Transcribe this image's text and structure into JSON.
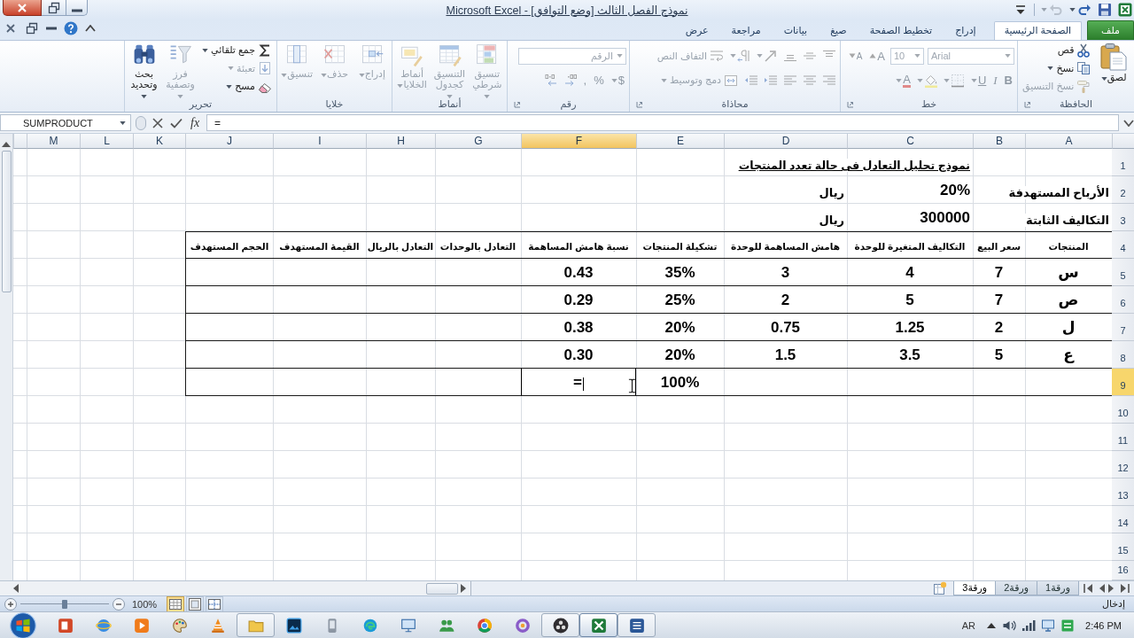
{
  "window": {
    "title": "نموذج الفصل الثالث [وضع التوافق] - Microsoft Excel"
  },
  "quick_access": [
    {
      "disabled": false
    },
    {
      "disabled": false
    },
    {
      "disabled": true
    }
  ],
  "ribbon_tabs": [
    {
      "kind": "file",
      "label": "ملف",
      "selected": false
    },
    {
      "kind": "tab",
      "label": "الصفحة الرئيسية",
      "selected": true
    },
    {
      "kind": "tab",
      "label": "إدراج",
      "selected": false
    },
    {
      "kind": "tab",
      "label": "تخطيط الصفحة",
      "selected": false
    },
    {
      "kind": "tab",
      "label": "صيغ",
      "selected": false
    },
    {
      "kind": "tab",
      "label": "بيانات",
      "selected": false
    },
    {
      "kind": "tab",
      "label": "مراجعة",
      "selected": false
    },
    {
      "kind": "tab",
      "label": "عرض",
      "selected": false
    }
  ],
  "ribbon": {
    "groups": [
      {
        "label": "الحافظة",
        "launcher": true,
        "blocks": [
          {
            "kind": "large",
            "label": "لصق",
            "dropdown": true,
            "disabled": false
          },
          {
            "kind": "rows",
            "rows": [
              {
                "items": [
                  {
                    "kind": "button",
                    "label": "قص",
                    "dropdown": false,
                    "disabled": false
                  }
                ]
              },
              {
                "items": [
                  {
                    "kind": "button",
                    "label": "نسخ",
                    "dropdown": true,
                    "disabled": false
                  }
                ]
              },
              {
                "items": [
                  {
                    "kind": "button",
                    "label": "نسخ التنسيق",
                    "dropdown": false,
                    "disabled": true
                  }
                ]
              }
            ]
          }
        ]
      },
      {
        "label": "خط",
        "launcher": true,
        "blocks": [
          {
            "kind": "rows",
            "rows": [
              {
                "items": [
                  {
                    "kind": "combo",
                    "value": "Arial",
                    "dropdown": true,
                    "disabled": true
                  },
                  {
                    "kind": "combo",
                    "value": "10",
                    "dropdown": true,
                    "disabled": true
                  },
                  {
                    "kind": "glyph",
                    "label": "A",
                    "dropdown": false,
                    "disabled": true
                  },
                  {
                    "kind": "glyph",
                    "label": "A",
                    "dropdown": false,
                    "disabled": true
                  }
                ]
              },
              {
                "items": [
                  {
                    "kind": "glyph",
                    "label": "B",
                    "dropdown": false,
                    "disabled": true
                  },
                  {
                    "kind": "glyph",
                    "label": "I",
                    "dropdown": false,
                    "disabled": true
                  },
                  {
                    "kind": "glyph",
                    "label": "U",
                    "dropdown": true,
                    "disabled": true
                  },
                  {
                    "kind": "icon",
                    "dropdown": true,
                    "disabled": true
                  },
                  {
                    "kind": "icon",
                    "dropdown": true,
                    "disabled": true
                  },
                  {
                    "kind": "glyph",
                    "label": "A",
                    "dropdown": true,
                    "disabled": true
                  }
                ]
              }
            ]
          }
        ]
      },
      {
        "label": "محاذاة",
        "launcher": true,
        "blocks": [
          {
            "kind": "rows",
            "rows": [
              {
                "items": [
                  {
                    "kind": "icon",
                    "dropdown": false,
                    "disabled": true
                  },
                  {
                    "kind": "icon",
                    "dropdown": false,
                    "disabled": true
                  },
                  {
                    "kind": "icon",
                    "dropdown": false,
                    "disabled": true
                  },
                  {
                    "kind": "icon",
                    "dropdown": true,
                    "disabled": true
                  },
                  {
                    "kind": "icon",
                    "dropdown": true,
                    "disabled": true
                  },
                  {
                    "kind": "button",
                    "label": "التفاف النص",
                    "dropdown": false,
                    "disabled": true
                  }
                ]
              },
              {
                "items": [
                  {
                    "kind": "icon",
                    "dropdown": false,
                    "disabled": true
                  },
                  {
                    "kind": "icon",
                    "dropdown": false,
                    "disabled": true
                  },
                  {
                    "kind": "icon",
                    "dropdown": false,
                    "disabled": true
                  },
                  {
                    "kind": "icon",
                    "dropdown": false,
                    "disabled": true
                  },
                  {
                    "kind": "icon",
                    "dropdown": false,
                    "disabled": true
                  },
                  {
                    "kind": "button",
                    "label": "دمج وتوسيط",
                    "dropdown": true,
                    "disabled": true
                  }
                ]
              }
            ]
          }
        ]
      },
      {
        "label": "رقم",
        "launcher": true,
        "blocks": [
          {
            "kind": "rows",
            "rows": [
              {
                "items": [
                  {
                    "kind": "combo",
                    "value": "الرقم",
                    "dropdown": true,
                    "disabled": true
                  }
                ]
              },
              {
                "items": [
                  {
                    "kind": "glyph",
                    "label": "$",
                    "dropdown": true,
                    "disabled": true
                  },
                  {
                    "kind": "glyph",
                    "label": "%",
                    "dropdown": false,
                    "disabled": true
                  },
                  {
                    "kind": "glyph",
                    "label": ",",
                    "dropdown": false,
                    "disabled": true
                  },
                  {
                    "kind": "icon",
                    "dropdown": false,
                    "disabled": true
                  },
                  {
                    "kind": "icon",
                    "dropdown": false,
                    "disabled": true
                  }
                ]
              }
            ]
          }
        ]
      },
      {
        "label": "أنماط",
        "launcher": false,
        "blocks": [
          {
            "kind": "large",
            "label": "تنسيق شرطي",
            "dropdown": true,
            "disabled": true
          },
          {
            "kind": "large",
            "label": "التنسيق كجدول",
            "dropdown": true,
            "disabled": true
          },
          {
            "kind": "large",
            "label": "أنماط الخلايا",
            "dropdown": true,
            "disabled": true
          }
        ]
      },
      {
        "label": "خلايا",
        "launcher": false,
        "blocks": [
          {
            "kind": "large",
            "label": "إدراج",
            "dropdown": true,
            "disabled": true
          },
          {
            "kind": "large",
            "label": "حذف",
            "dropdown": true,
            "disabled": true
          },
          {
            "kind": "large",
            "label": "تنسيق",
            "dropdown": true,
            "disabled": true
          }
        ]
      },
      {
        "label": "تحرير",
        "launcher": false,
        "blocks": [
          {
            "kind": "rows",
            "rows": [
              {
                "items": [
                  {
                    "kind": "button",
                    "label": "جمع تلقائي",
                    "dropdown": true,
                    "disabled": false
                  }
                ]
              },
              {
                "items": [
                  {
                    "kind": "button",
                    "label": "تعبئة",
                    "dropdown": true,
                    "disabled": true
                  }
                ]
              },
              {
                "items": [
                  {
                    "kind": "button",
                    "label": "مسح",
                    "dropdown": true,
                    "disabled": false
                  }
                ]
              }
            ]
          },
          {
            "kind": "large",
            "label": "فرز وتصفية",
            "dropdown": true,
            "disabled": true
          },
          {
            "kind": "large",
            "label": "بحث وتحديد",
            "dropdown": true,
            "disabled": false
          }
        ]
      }
    ]
  },
  "formula_bar": {
    "name_box": "SUMPRODUCT",
    "function_button": "fx",
    "content": "="
  },
  "sheet": {
    "edit_mode": true,
    "columns": [
      {
        "label": "A",
        "selected": false
      },
      {
        "label": "B",
        "selected": false
      },
      {
        "label": "C",
        "selected": false
      },
      {
        "label": "D",
        "selected": false
      },
      {
        "label": "E",
        "selected": false
      },
      {
        "label": "F",
        "selected": true
      },
      {
        "label": "G",
        "selected": false
      },
      {
        "label": "H",
        "selected": false
      },
      {
        "label": "I",
        "selected": false
      },
      {
        "label": "J",
        "selected": false
      },
      {
        "label": "K",
        "selected": false
      },
      {
        "label": "L",
        "selected": false
      },
      {
        "label": "M",
        "selected": false
      }
    ],
    "rows": [
      {
        "label": "1",
        "selected": false,
        "cells": [
          {
            "kind": "blank"
          },
          {
            "kind": "blank"
          },
          {
            "kind": "title",
            "text": "نموذج تحليل التعادل فى حالة تعدد المنتجات"
          }
        ]
      },
      {
        "label": "2",
        "selected": false,
        "cells": [
          {
            "kind": "label",
            "text": "الأرباح المستهدفة"
          },
          {
            "kind": "blank"
          },
          {
            "kind": "number",
            "text": "20%"
          },
          {
            "kind": "label",
            "text": "ريال"
          }
        ]
      },
      {
        "label": "3",
        "selected": false,
        "cells": [
          {
            "kind": "label",
            "text": "التكاليف الثابتة"
          },
          {
            "kind": "blank"
          },
          {
            "kind": "number",
            "text": "300000"
          },
          {
            "kind": "label",
            "text": "ريال"
          }
        ]
      },
      {
        "label": "4",
        "selected": false,
        "cells": [
          {
            "kind": "header",
            "text": "المنتجات"
          },
          {
            "kind": "header",
            "text": "سعر البيع"
          },
          {
            "kind": "header",
            "text": "التكاليف المتغيرة للوحدة"
          },
          {
            "kind": "header",
            "text": "هامش المساهمة للوحدة"
          },
          {
            "kind": "header",
            "text": "تشكيلة المنتجات"
          },
          {
            "kind": "header",
            "text": "نسبة هامش المساهمة"
          },
          {
            "kind": "header",
            "text": "التعادل بالوحدات"
          },
          {
            "kind": "header",
            "text": "التعادل بالريال"
          },
          {
            "kind": "header",
            "text": "القيمة المستهدف"
          },
          {
            "kind": "header",
            "text": "الحجم المستهدف"
          }
        ]
      },
      {
        "label": "5",
        "selected": false,
        "cells": [
          {
            "kind": "value",
            "text": "س"
          },
          {
            "kind": "value",
            "text": "7"
          },
          {
            "kind": "value",
            "text": "4"
          },
          {
            "kind": "value",
            "text": "3"
          },
          {
            "kind": "value",
            "text": "35%"
          },
          {
            "kind": "value",
            "text": "0.43"
          },
          {
            "kind": "value"
          },
          {
            "kind": "value"
          },
          {
            "kind": "value"
          },
          {
            "kind": "value"
          }
        ]
      },
      {
        "label": "6",
        "selected": false,
        "cells": [
          {
            "kind": "value",
            "text": "ص"
          },
          {
            "kind": "value",
            "text": "7"
          },
          {
            "kind": "value",
            "text": "5"
          },
          {
            "kind": "value",
            "text": "2"
          },
          {
            "kind": "value",
            "text": "25%"
          },
          {
            "kind": "value",
            "text": "0.29"
          },
          {
            "kind": "value"
          },
          {
            "kind": "value"
          },
          {
            "kind": "value"
          },
          {
            "kind": "value"
          }
        ]
      },
      {
        "label": "7",
        "selected": false,
        "cells": [
          {
            "kind": "value",
            "text": "ل"
          },
          {
            "kind": "value",
            "text": "2"
          },
          {
            "kind": "value",
            "text": "1.25"
          },
          {
            "kind": "value",
            "text": "0.75"
          },
          {
            "kind": "value",
            "text": "20%"
          },
          {
            "kind": "value",
            "text": "0.38"
          },
          {
            "kind": "value"
          },
          {
            "kind": "value"
          },
          {
            "kind": "value"
          },
          {
            "kind": "value"
          }
        ]
      },
      {
        "label": "8",
        "selected": false,
        "cells": [
          {
            "kind": "value",
            "text": "ع"
          },
          {
            "kind": "value",
            "text": "5"
          },
          {
            "kind": "value",
            "text": "3.5"
          },
          {
            "kind": "value",
            "text": "1.5"
          },
          {
            "kind": "value",
            "text": "20%"
          },
          {
            "kind": "value",
            "text": "0.30"
          },
          {
            "kind": "value"
          },
          {
            "kind": "value"
          },
          {
            "kind": "value"
          },
          {
            "kind": "value"
          }
        ]
      },
      {
        "label": "9",
        "selected": true,
        "cells": [
          {
            "kind": "value"
          },
          {
            "kind": "value"
          },
          {
            "kind": "value"
          },
          {
            "kind": "value"
          },
          {
            "kind": "value",
            "text": "100%"
          },
          {
            "kind": "value",
            "text": "="
          },
          {
            "kind": "value"
          },
          {
            "kind": "value"
          },
          {
            "kind": "value"
          },
          {
            "kind": "value"
          }
        ]
      },
      {
        "label": "10",
        "selected": false
      },
      {
        "label": "11",
        "selected": false
      },
      {
        "label": "12",
        "selected": false
      },
      {
        "label": "13",
        "selected": false
      },
      {
        "label": "14",
        "selected": false
      },
      {
        "label": "15",
        "selected": false
      },
      {
        "label": "16",
        "selected": false
      }
    ]
  },
  "sheet_tabs": [
    {
      "label": "ورقة1",
      "selected": false
    },
    {
      "label": "ورقة2",
      "selected": false
    },
    {
      "label": "ورقة3",
      "selected": true
    }
  ],
  "status_bar": {
    "mode": "إدخال",
    "zoom": "100%",
    "zoom_slider": {
      "level": 0.5
    },
    "views": [
      {
        "selected": true
      },
      {
        "selected": false
      },
      {
        "selected": false
      }
    ]
  },
  "taskbar": {
    "apps": [
      {
        "running": false,
        "selected": false
      },
      {
        "running": false,
        "selected": false
      },
      {
        "running": false,
        "selected": false
      },
      {
        "running": false,
        "selected": false
      },
      {
        "running": false,
        "selected": false
      },
      {
        "running": true,
        "selected": false
      },
      {
        "running": false,
        "selected": false
      },
      {
        "running": false,
        "selected": false
      },
      {
        "running": false,
        "selected": false
      },
      {
        "running": false,
        "selected": false
      },
      {
        "running": false,
        "selected": false
      },
      {
        "running": false,
        "selected": false
      },
      {
        "running": false,
        "selected": false
      },
      {
        "running": true,
        "selected": false
      },
      {
        "running": true,
        "selected": true
      },
      {
        "running": true,
        "selected": false
      }
    ],
    "language": "AR",
    "clock": "2:46 PM"
  }
}
